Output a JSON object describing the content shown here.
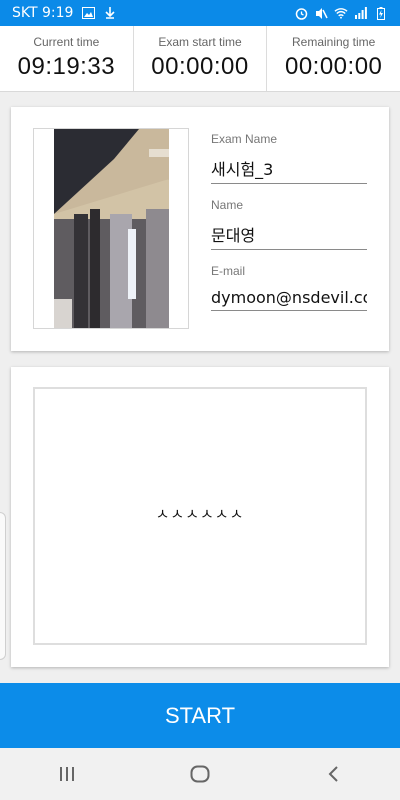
{
  "status": {
    "carrier_time": "SKT 9:19",
    "icons": [
      "image-icon",
      "download-icon",
      "alarm-icon",
      "mute-icon",
      "wifi-icon",
      "signal-icon",
      "battery-icon"
    ]
  },
  "timers": {
    "current": {
      "label": "Current time",
      "value": "09:19:33"
    },
    "start": {
      "label": "Exam start time",
      "value": "00:00:00"
    },
    "remaining": {
      "label": "Remaining time",
      "value": "00:00:00"
    }
  },
  "profile": {
    "exam_name_label": "Exam Name",
    "exam_name": "새시험_3",
    "name_label": "Name",
    "name": "문대영",
    "email_label": "E-mail",
    "email": "dymoon@nsdevil.cor"
  },
  "signature": {
    "text": "ㅅㅅㅅㅅㅅㅅ"
  },
  "actions": {
    "start_label": "START"
  },
  "colors": {
    "accent": "#0c8ce9",
    "statusbar": "#0b8ae8"
  }
}
